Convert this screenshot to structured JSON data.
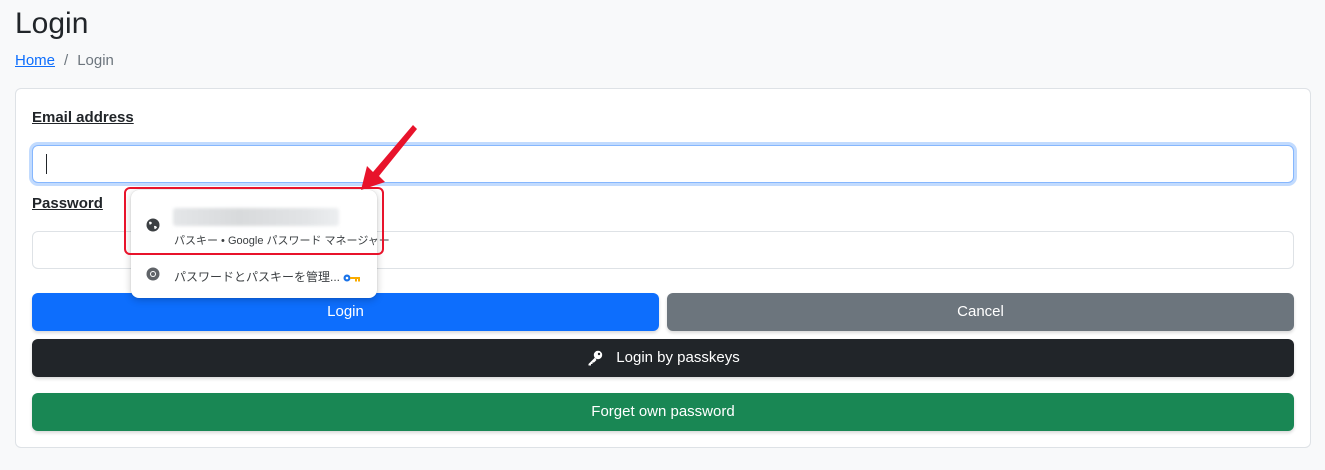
{
  "page": {
    "title": "Login"
  },
  "breadcrumb": {
    "home": "Home",
    "separator": "/",
    "current": "Login"
  },
  "form": {
    "email_label": "Email address",
    "email_value": "",
    "password_label": "Password",
    "password_value": ""
  },
  "buttons": {
    "login": "Login",
    "cancel": "Cancel",
    "passkeys": "Login by passkeys",
    "forget": "Forget own password"
  },
  "autofill_popup": {
    "entry_subtitle": "パスキー • Google パスワード マネージャー",
    "manage_label": "パスワードとパスキーを管理...",
    "icons": [
      "globe-icon",
      "chrome-icon",
      "key-icon"
    ]
  },
  "annotation": {
    "color": "#e8132b"
  },
  "colors": {
    "primary": "#0d6efd",
    "secondary": "#6c757d",
    "dark": "#212529",
    "success": "#198754",
    "focus_border": "#86b7fe"
  }
}
